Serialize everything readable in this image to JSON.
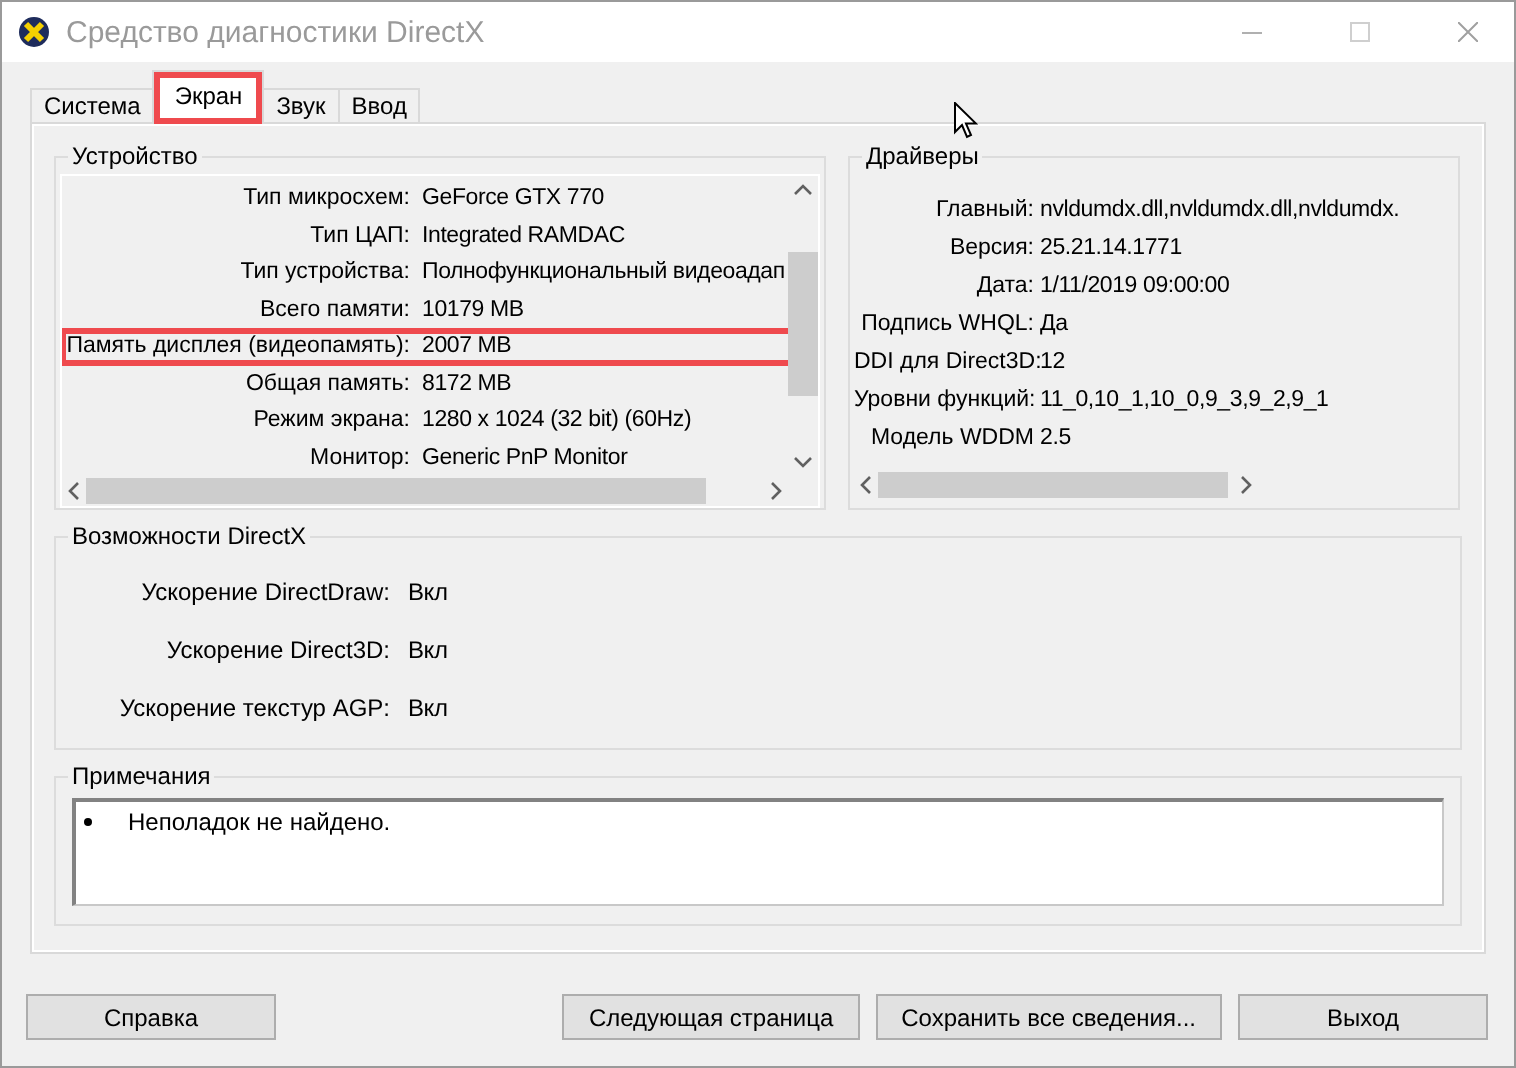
{
  "window": {
    "title": "Средство диагностики DirectX"
  },
  "tabs": [
    {
      "label": "Система",
      "selected": false,
      "highlighted": false
    },
    {
      "label": "Экран",
      "selected": true,
      "highlighted": true
    },
    {
      "label": "Звук",
      "selected": false,
      "highlighted": false
    },
    {
      "label": "Ввод",
      "selected": false,
      "highlighted": false
    }
  ],
  "device": {
    "title": "Устройство",
    "rows": [
      {
        "label": "Тип микросхем:",
        "value": "GeForce GTX 770",
        "highlighted": false
      },
      {
        "label": "Тип ЦАП:",
        "value": "Integrated RAMDAC",
        "highlighted": false
      },
      {
        "label": "Тип устройства:",
        "value": "Полнофункциональный видеоадап",
        "highlighted": false
      },
      {
        "label": "Всего памяти:",
        "value": "10179 MB",
        "highlighted": false
      },
      {
        "label": "Память дисплея (видеопамять):",
        "value": "2007 MB",
        "highlighted": true
      },
      {
        "label": "Общая память:",
        "value": "8172 MB",
        "highlighted": false
      },
      {
        "label": "Режим экрана:",
        "value": "1280 x 1024 (32 bit) (60Hz)",
        "highlighted": false
      },
      {
        "label": "Монитор:",
        "value": "Generic PnP Monitor",
        "highlighted": false
      }
    ]
  },
  "drivers": {
    "title": "Драйверы",
    "rows": [
      {
        "label": "Главный:",
        "value": "nvldumdx.dll,nvldumdx.dll,nvldumdx."
      },
      {
        "label": "Версия:",
        "value": "25.21.14.1771"
      },
      {
        "label": "Дата:",
        "value": "1/11/2019 09:00:00"
      },
      {
        "label": "Подпись WHQL:",
        "value": "Да"
      },
      {
        "label": "DDI для Direct3D:",
        "value": "12"
      },
      {
        "label": "Уровни функций:",
        "value": "11_0,10_1,10_0,9_3,9_2,9_1"
      },
      {
        "label": "Модель WDDM",
        "value": "2.5"
      }
    ]
  },
  "directx": {
    "title": "Возможности DirectX",
    "rows": [
      {
        "label": "Ускорение DirectDraw:",
        "value": "Вкл"
      },
      {
        "label": "Ускорение Direct3D:",
        "value": "Вкл"
      },
      {
        "label": "Ускорение текстур AGP:",
        "value": "Вкл"
      }
    ]
  },
  "notes": {
    "title": "Примечания",
    "items": [
      "Неполадок не найдено."
    ]
  },
  "buttons": [
    {
      "label": "Справка",
      "kind": "left"
    },
    {
      "label": "Следующая страница",
      "kind": "right"
    },
    {
      "label": "Сохранить все сведения...",
      "kind": "right"
    },
    {
      "label": "Выход",
      "kind": "right"
    }
  ]
}
